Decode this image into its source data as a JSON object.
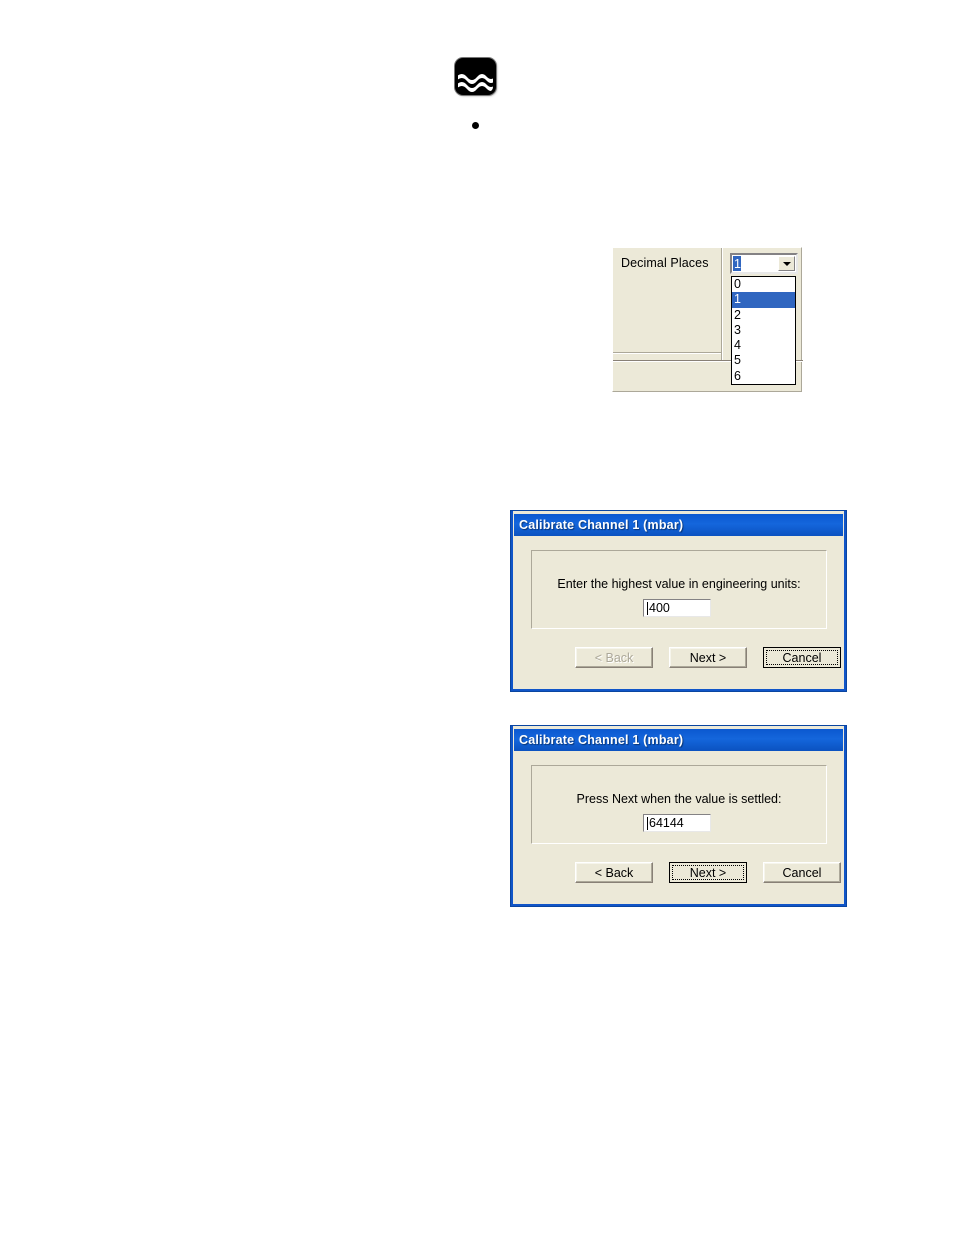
{
  "page": {
    "background_color": "#ffffff",
    "figures": [
      "wave-icon",
      "bullet",
      "decimal-places-panel",
      "calibrate-dialog-highest-value",
      "calibrate-dialog-value-settled"
    ]
  },
  "colors": {
    "dialog_face": "#ECE9D8",
    "titlebar_blue": "#1466DC",
    "selection_blue": "#3066C0",
    "border_shadow": "#ACA899",
    "text": "#000000",
    "disabled_text": "#ACA899",
    "field_white": "#FFFFFF"
  },
  "wave_icon": {
    "icon": "water-waves-icon",
    "description": "black rounded-square icon with white wave lines"
  },
  "bullet": {
    "glyph": "•"
  },
  "decimal_places_panel": {
    "label": "Decimal Places",
    "combo": {
      "name": "decimal-places-combobox",
      "value": "1",
      "expanded": true,
      "arrow_icon": "chevron-down-icon",
      "options": [
        "0",
        "1",
        "2",
        "3",
        "4",
        "5",
        "6"
      ],
      "selected_index": 1
    }
  },
  "dialog_highest": {
    "title": "Calibrate Channel 1 (mbar)",
    "prompt": "Enter the highest value in engineering units:",
    "field": {
      "name": "highest-value-input",
      "value": "400"
    },
    "buttons": [
      {
        "name": "back-button",
        "label": "< Back",
        "state": "disabled"
      },
      {
        "name": "next-button",
        "label": "Next >",
        "state": "normal"
      },
      {
        "name": "cancel-button",
        "label": "Cancel",
        "state": "focused"
      }
    ]
  },
  "dialog_settled": {
    "title": "Calibrate Channel 1 (mbar)",
    "prompt": "Press Next when the value is settled:",
    "field": {
      "name": "settled-value-input",
      "value": "64144"
    },
    "buttons": [
      {
        "name": "back-button",
        "label": "< Back",
        "state": "normal"
      },
      {
        "name": "next-button",
        "label": "Next >",
        "state": "focused"
      },
      {
        "name": "cancel-button",
        "label": "Cancel",
        "state": "normal"
      }
    ]
  }
}
